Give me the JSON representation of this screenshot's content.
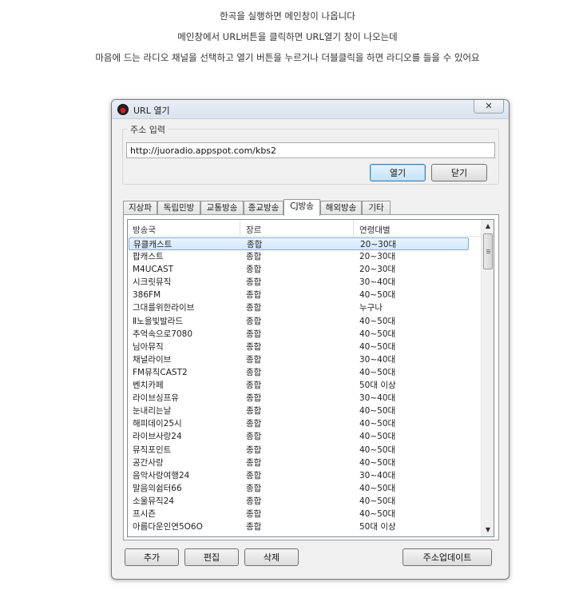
{
  "intro": {
    "line1": "한곡을 실행하면 메인창이 나옵니다",
    "line2": "메인창에서 URL버튼을 클릭하면 URL열기 창이 나오는데",
    "line3": "마음에 드는 라디오 채널을 선택하고 열기 버튼을 누르거나 더블클릭을 하면 라디오를 들을 수 있어요"
  },
  "window": {
    "title": "URL 열기",
    "close_label": "✕"
  },
  "address": {
    "group_label": "주소 입력",
    "url_value": "http://juoradio.appspot.com/kbs2",
    "open_label": "열기",
    "close_label": "닫기"
  },
  "tabs": [
    "지상파",
    "독립민방",
    "교통방송",
    "종교방송",
    "CJ방송",
    "해외방송",
    "기타"
  ],
  "active_tab": "CJ방송",
  "list": {
    "columns": [
      "방송국",
      "장르",
      "연령대별"
    ],
    "rows": [
      [
        "뮤클캐스트",
        "종합",
        "20~30대"
      ],
      [
        "팝캐스트",
        "종합",
        "20~30대"
      ],
      [
        "M4UCAST",
        "종합",
        "20~30대"
      ],
      [
        "시크릿뮤직",
        "종합",
        "30~40대"
      ],
      [
        "386FM",
        "종합",
        "40~50대"
      ],
      [
        "그대를위한라이브",
        "종합",
        "누구나"
      ],
      [
        "Ⅱ노을빛발라드",
        "종합",
        "40~50대"
      ],
      [
        "추억속으로7080",
        "종합",
        "40~50대"
      ],
      [
        "님아뮤직",
        "종합",
        "40~50대"
      ],
      [
        "채널라이브",
        "종합",
        "30~40대"
      ],
      [
        "FM뮤직CAST2",
        "종합",
        "40~50대"
      ],
      [
        "벤치카페",
        "종합",
        "50대 이상"
      ],
      [
        "라이브싱프유",
        "종합",
        "30~40대"
      ],
      [
        "눈내리는날",
        "종합",
        "40~50대"
      ],
      [
        "해피데이25시",
        "종합",
        "40~50대"
      ],
      [
        "라이브사랑24",
        "종합",
        "40~50대"
      ],
      [
        "뮤직포인트",
        "종합",
        "40~50대"
      ],
      [
        "공간사랑",
        "종합",
        "40~50대"
      ],
      [
        "음악사랑여행24",
        "종합",
        "30~40대"
      ],
      [
        "말음의쉼터66",
        "종합",
        "40~50대"
      ],
      [
        "소울뮤직24",
        "종합",
        "40~50대"
      ],
      [
        "프시즌",
        "종합",
        "40~50대"
      ],
      [
        "아름다운인연5O6O",
        "종합",
        "50대 이상"
      ]
    ]
  },
  "bottom": {
    "add_label": "추가",
    "edit_label": "편집",
    "delete_label": "삭제",
    "update_label": "주소업데이트"
  }
}
